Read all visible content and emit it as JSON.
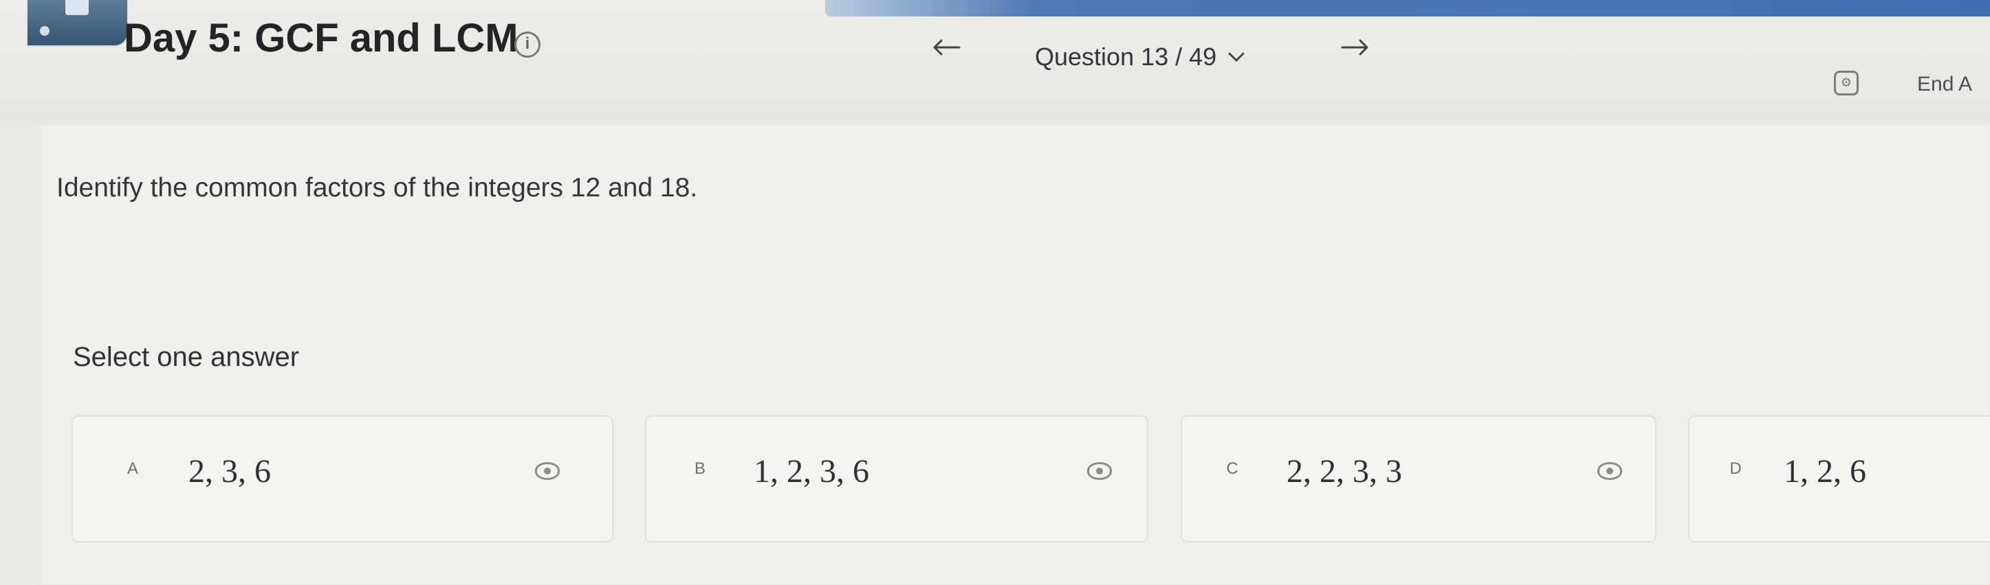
{
  "header": {
    "title": "Day 5: GCF and LCM",
    "question_counter": "Question 13 / 49",
    "end_label": "End A"
  },
  "icons": {
    "info": "info-icon",
    "prev": "arrow-left-icon",
    "next": "arrow-right-icon",
    "dropdown": "chevron-down-icon",
    "settings": "settings-icon",
    "option_control": "eye-icon"
  },
  "question": {
    "prompt": "Identify the common factors of the integers 12 and 18.",
    "instruction": "Select one answer"
  },
  "answers": [
    {
      "letter": "A",
      "value": "2, 3, 6"
    },
    {
      "letter": "B",
      "value": "1, 2, 3, 6"
    },
    {
      "letter": "C",
      "value": "2, 2, 3, 3"
    },
    {
      "letter": "D",
      "value": "1, 2, 6"
    }
  ],
  "colors": {
    "accent": "#3f6fb1",
    "background": "#e8e8e6",
    "panel": "#efefed",
    "text": "#2f2f33"
  }
}
